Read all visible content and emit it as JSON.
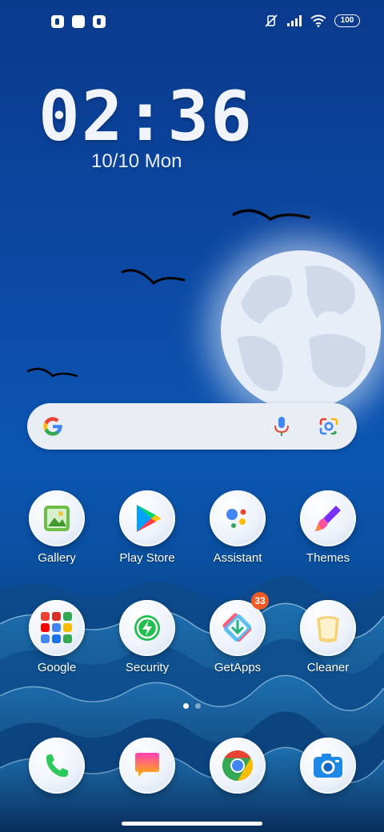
{
  "status": {
    "battery": "100",
    "icons": [
      "notification-icon",
      "notification-icon",
      "notification-icon",
      "vibrate-off-icon",
      "signal-icon",
      "wifi-icon",
      "battery-icon"
    ]
  },
  "lockscreen": {
    "time": "02:36",
    "date": "10/10 Mon"
  },
  "search": {
    "icons": [
      "google-g-icon",
      "microphone-icon",
      "google-lens-icon"
    ]
  },
  "apps": [
    {
      "label": "Gallery"
    },
    {
      "label": "Play Store"
    },
    {
      "label": "Assistant"
    },
    {
      "label": "Themes"
    },
    {
      "label": "Google"
    },
    {
      "label": "Security"
    },
    {
      "label": "GetApps",
      "badge": "33"
    },
    {
      "label": "Cleaner"
    }
  ],
  "dock": [
    "phone-icon",
    "messages-icon",
    "chrome-icon",
    "camera-icon"
  ],
  "pager": {
    "pages": 2,
    "current": 1
  }
}
